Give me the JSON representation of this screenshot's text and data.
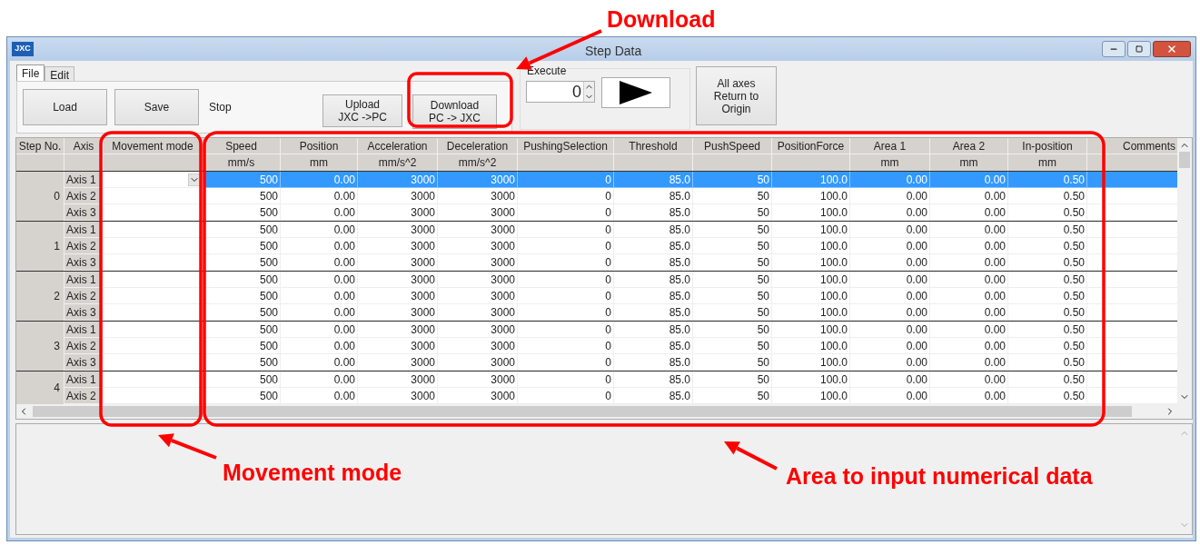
{
  "window": {
    "logo": "JXC",
    "title": "Step Data"
  },
  "tabs": [
    {
      "label": "File",
      "selected": true
    },
    {
      "label": "Edit",
      "selected": false
    }
  ],
  "toolbar": {
    "load": "Load",
    "save": "Save",
    "status": "Stop",
    "upload": [
      "Upload",
      "JXC ->PC"
    ],
    "download": [
      "Download",
      "PC -> JXC"
    ]
  },
  "execute": {
    "label": "Execute",
    "value": "0"
  },
  "origin_button": [
    "All axes",
    "Return to",
    "Origin"
  ],
  "table": {
    "columns": [
      {
        "name": "Step No."
      },
      {
        "name": "Axis"
      },
      {
        "name": "Movement mode"
      },
      {
        "name": "Speed",
        "unit": "mm/s"
      },
      {
        "name": "Position",
        "unit": "mm"
      },
      {
        "name": "Acceleration",
        "unit": "mm/s^2"
      },
      {
        "name": "Deceleration",
        "unit": "mm/s^2"
      },
      {
        "name": "PushingSelection"
      },
      {
        "name": "Threshold"
      },
      {
        "name": "PushSpeed"
      },
      {
        "name": "PositionForce"
      },
      {
        "name": "Area 1",
        "unit": "mm"
      },
      {
        "name": "Area 2",
        "unit": "mm"
      },
      {
        "name": "In-position",
        "unit": "mm"
      },
      {
        "name": "Comments"
      }
    ],
    "steps": [
      {
        "no": "0",
        "axes": [
          {
            "axis": "Axis 1",
            "selected": true,
            "values": [
              "500",
              "0.00",
              "3000",
              "3000",
              "0",
              "85.0",
              "50",
              "100.0",
              "0.00",
              "0.00",
              "0.50"
            ]
          },
          {
            "axis": "Axis 2",
            "selected": false,
            "values": [
              "500",
              "0.00",
              "3000",
              "3000",
              "0",
              "85.0",
              "50",
              "100.0",
              "0.00",
              "0.00",
              "0.50"
            ]
          },
          {
            "axis": "Axis 3",
            "selected": false,
            "values": [
              "500",
              "0.00",
              "3000",
              "3000",
              "0",
              "85.0",
              "50",
              "100.0",
              "0.00",
              "0.00",
              "0.50"
            ]
          }
        ]
      },
      {
        "no": "1",
        "axes": [
          {
            "axis": "Axis 1",
            "selected": false,
            "values": [
              "500",
              "0.00",
              "3000",
              "3000",
              "0",
              "85.0",
              "50",
              "100.0",
              "0.00",
              "0.00",
              "0.50"
            ]
          },
          {
            "axis": "Axis 2",
            "selected": false,
            "values": [
              "500",
              "0.00",
              "3000",
              "3000",
              "0",
              "85.0",
              "50",
              "100.0",
              "0.00",
              "0.00",
              "0.50"
            ]
          },
          {
            "axis": "Axis 3",
            "selected": false,
            "values": [
              "500",
              "0.00",
              "3000",
              "3000",
              "0",
              "85.0",
              "50",
              "100.0",
              "0.00",
              "0.00",
              "0.50"
            ]
          }
        ]
      },
      {
        "no": "2",
        "axes": [
          {
            "axis": "Axis 1",
            "selected": false,
            "values": [
              "500",
              "0.00",
              "3000",
              "3000",
              "0",
              "85.0",
              "50",
              "100.0",
              "0.00",
              "0.00",
              "0.50"
            ]
          },
          {
            "axis": "Axis 2",
            "selected": false,
            "values": [
              "500",
              "0.00",
              "3000",
              "3000",
              "0",
              "85.0",
              "50",
              "100.0",
              "0.00",
              "0.00",
              "0.50"
            ]
          },
          {
            "axis": "Axis 3",
            "selected": false,
            "values": [
              "500",
              "0.00",
              "3000",
              "3000",
              "0",
              "85.0",
              "50",
              "100.0",
              "0.00",
              "0.00",
              "0.50"
            ]
          }
        ]
      },
      {
        "no": "3",
        "axes": [
          {
            "axis": "Axis 1",
            "selected": false,
            "values": [
              "500",
              "0.00",
              "3000",
              "3000",
              "0",
              "85.0",
              "50",
              "100.0",
              "0.00",
              "0.00",
              "0.50"
            ]
          },
          {
            "axis": "Axis 2",
            "selected": false,
            "values": [
              "500",
              "0.00",
              "3000",
              "3000",
              "0",
              "85.0",
              "50",
              "100.0",
              "0.00",
              "0.00",
              "0.50"
            ]
          },
          {
            "axis": "Axis 3",
            "selected": false,
            "values": [
              "500",
              "0.00",
              "3000",
              "3000",
              "0",
              "85.0",
              "50",
              "100.0",
              "0.00",
              "0.00",
              "0.50"
            ]
          }
        ]
      },
      {
        "no": "4",
        "axes": [
          {
            "axis": "Axis 1",
            "selected": false,
            "values": [
              "500",
              "0.00",
              "3000",
              "3000",
              "0",
              "85.0",
              "50",
              "100.0",
              "0.00",
              "0.00",
              "0.50"
            ]
          },
          {
            "axis": "Axis 2",
            "selected": false,
            "values": [
              "500",
              "0.00",
              "3000",
              "3000",
              "0",
              "85.0",
              "50",
              "100.0",
              "0.00",
              "0.00",
              "0.50"
            ]
          }
        ]
      }
    ]
  },
  "annotations": [
    {
      "text": "Download"
    },
    {
      "text": "Movement mode"
    },
    {
      "text": "Area to input numerical data"
    }
  ]
}
